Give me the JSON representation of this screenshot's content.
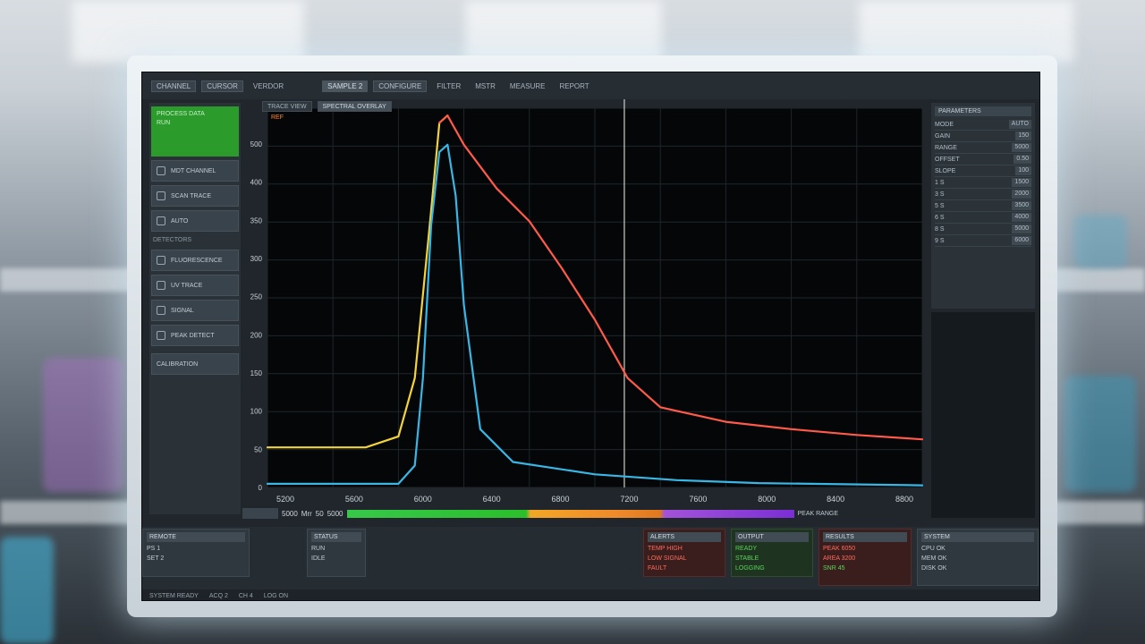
{
  "topbar": {
    "items": [
      "CHANNEL",
      "CURSOR",
      "VERDOR",
      "SAMPLE 2",
      "CONFIGURE",
      "FILTER",
      "MSTR",
      "MEASURE",
      "REPORT"
    ]
  },
  "sidebar": {
    "active_label": "PROCESS DATA",
    "active_sub": "RUN",
    "items": [
      "MDT CHANNEL",
      "SCAN TRACE",
      "AUTO"
    ],
    "section": "DETECTORS",
    "items2": [
      "FLUORESCENCE",
      "UV TRACE",
      "SIGNAL",
      "PEAK DETECT"
    ],
    "bottom": "CALIBRATION"
  },
  "chart": {
    "tabs": [
      "TRACE VIEW",
      "SPECTRAL OVERLAY"
    ],
    "legend": "REF",
    "y_ticks": [
      "500",
      "400",
      "350",
      "300",
      "250",
      "200",
      "150",
      "100",
      "50",
      "0"
    ],
    "x_ticks": [
      "5200",
      "5600",
      "6000",
      "6400",
      "6800",
      "7200",
      "7600",
      "8000",
      "8400",
      "8800"
    ],
    "colors": {
      "red": "#ff5a4a",
      "yellow": "#f2d43a",
      "blue": "#38b7e6",
      "cursor": "#c8d2c8"
    }
  },
  "chart_data": {
    "type": "line",
    "title": "",
    "xlabel": "",
    "ylabel": "",
    "xlim": [
      5000,
      9000
    ],
    "ylim": [
      0,
      520
    ],
    "cursor_x": 7180,
    "series": [
      {
        "color": "#f2d43a",
        "x": [
          5000,
          5600,
          5800,
          5900,
          6000,
          6050,
          6100
        ],
        "y": [
          55,
          55,
          70,
          150,
          380,
          500,
          510
        ]
      },
      {
        "color": "#ff5a4a",
        "x": [
          6050,
          6100,
          6200,
          6400,
          6600,
          6800,
          7000,
          7200,
          7400,
          7800,
          8200,
          8600,
          9000
        ],
        "y": [
          500,
          510,
          470,
          410,
          365,
          300,
          230,
          150,
          110,
          90,
          80,
          72,
          66
        ]
      },
      {
        "color": "#38b7e6",
        "x": [
          5000,
          5800,
          5900,
          5950,
          6000,
          6050,
          6100,
          6150,
          6200,
          6300,
          6500,
          7000,
          7500,
          8000,
          9000
        ],
        "y": [
          5,
          5,
          30,
          150,
          360,
          460,
          470,
          400,
          250,
          80,
          35,
          18,
          10,
          6,
          3
        ]
      }
    ]
  },
  "barrow": {
    "label_a": "5000",
    "label_b": "Mrr",
    "label_c": "50",
    "label_d": "5000",
    "legend": "PEAK RANGE"
  },
  "right_panel": {
    "header": "PARAMETERS",
    "rows": [
      {
        "k": "MODE",
        "v": "AUTO"
      },
      {
        "k": "GAIN",
        "v": "150"
      },
      {
        "k": "RANGE",
        "v": "5000"
      },
      {
        "k": "OFFSET",
        "v": "0.50"
      },
      {
        "k": "SLOPE",
        "v": "100"
      },
      {
        "k": "1 S",
        "v": "1500"
      },
      {
        "k": "3 S",
        "v": "2000"
      },
      {
        "k": "5 S",
        "v": "3500"
      },
      {
        "k": "6 S",
        "v": "4000"
      },
      {
        "k": "8 S",
        "v": "5000"
      },
      {
        "k": "9 S",
        "v": "6000"
      }
    ]
  },
  "bottom": {
    "p1_title": "REMOTE",
    "p1_lines": [
      "PS 1",
      "SET 2"
    ],
    "p2_title": "STATUS",
    "p2_lines": [
      "RUN",
      "IDLE"
    ],
    "p3_title": "ALERTS",
    "p3_lines": [
      "TEMP HIGH",
      "LOW SIGNAL",
      "FAULT"
    ],
    "p4_title": "OUTPUT",
    "p4_lines": [
      "READY",
      "STABLE",
      "LOGGING"
    ],
    "p5_title": "RESULTS",
    "p5_lines": [
      "PEAK 6050",
      "AREA 3200",
      "SNR 45"
    ],
    "p6_title": "SYSTEM",
    "p6_lines": [
      "CPU OK",
      "MEM OK",
      "DISK OK"
    ],
    "status": [
      "SYSTEM READY",
      "ACQ 2",
      "CH 4",
      "LOG ON"
    ]
  }
}
